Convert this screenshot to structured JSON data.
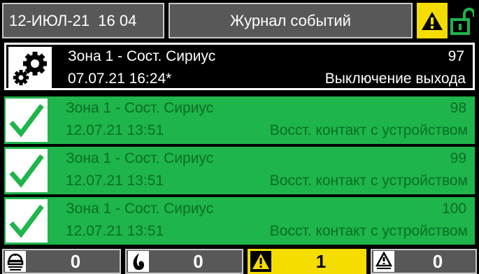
{
  "header": {
    "datetime": "12-ИЮЛ-21  16 04",
    "title": "Журнал событий",
    "status_icons": [
      "warning-icon",
      "unlocked-icon"
    ]
  },
  "events": [
    {
      "zone": "Зона 1 - Сост. Сириус",
      "number": "97",
      "datetime": "07.07.21 16:24*",
      "event": "Выключение выхода",
      "icon": "gear-icon",
      "selected": true
    },
    {
      "zone": "Зона 1 - Сост. Сириус",
      "number": "98",
      "datetime": "12.07.21 13:51",
      "event": "Восст. контакт с устройством",
      "icon": "checkmark-icon",
      "selected": false
    },
    {
      "zone": "Зона 1 - Сост. Сириус",
      "number": "99",
      "datetime": "12.07.21 13:51",
      "event": "Восст. контакт с устройством",
      "icon": "checkmark-icon",
      "selected": false
    },
    {
      "zone": "Зона 1 - Сост. Сириус",
      "number": "100",
      "datetime": "12.07.21 13:51",
      "event": "Восст. контакт с устройством",
      "icon": "checkmark-icon",
      "selected": false
    }
  ],
  "counters": [
    {
      "icon": "fire-alarm-icon",
      "value": "0"
    },
    {
      "icon": "flame-icon",
      "value": "0"
    },
    {
      "icon": "warning-icon",
      "value": "1"
    },
    {
      "icon": "fault-icon",
      "value": "0"
    }
  ],
  "colors": {
    "ok_row": "#1eb54a",
    "ok_text": "#0a6e26",
    "warning": "#f5dd00",
    "lock": "#1eb54a",
    "header_bg": "#585858"
  }
}
